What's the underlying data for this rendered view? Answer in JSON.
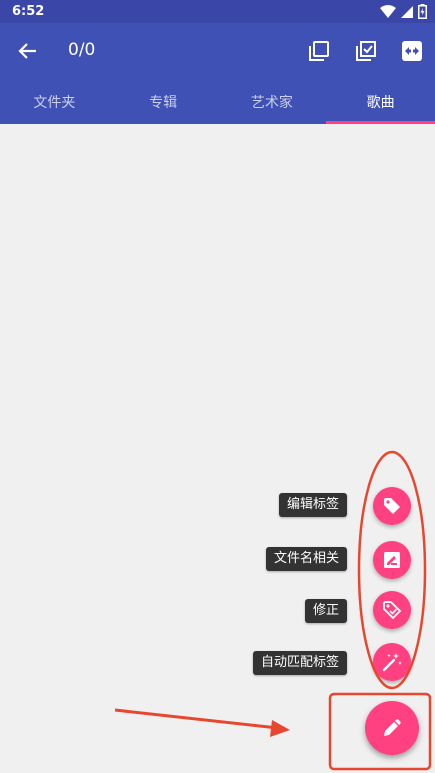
{
  "status_bar": {
    "time": "6:52"
  },
  "app_bar": {
    "counter": "0/0",
    "actions": [
      {
        "icon": "select-all-icon"
      },
      {
        "icon": "check-all-icon"
      },
      {
        "icon": "swap-icon"
      }
    ]
  },
  "tabs": [
    {
      "label": "文件夹",
      "active": false
    },
    {
      "label": "专辑",
      "active": false
    },
    {
      "label": "艺术家",
      "active": false
    },
    {
      "label": "歌曲",
      "active": true
    }
  ],
  "fab_menu": {
    "items": [
      {
        "label": "编辑标签",
        "icon": "tag-icon"
      },
      {
        "label": "文件名相关",
        "icon": "image-edit-icon"
      },
      {
        "label": "修正",
        "icon": "tag-fix-icon"
      },
      {
        "label": "自动匹配标签",
        "icon": "magic-wand-icon"
      }
    ],
    "main_icon": "pencil-icon"
  },
  "colors": {
    "primary": "#3f51b5",
    "primary_dark": "#3a47a8",
    "accent": "#ff4081",
    "annotation": "#e8472f"
  }
}
